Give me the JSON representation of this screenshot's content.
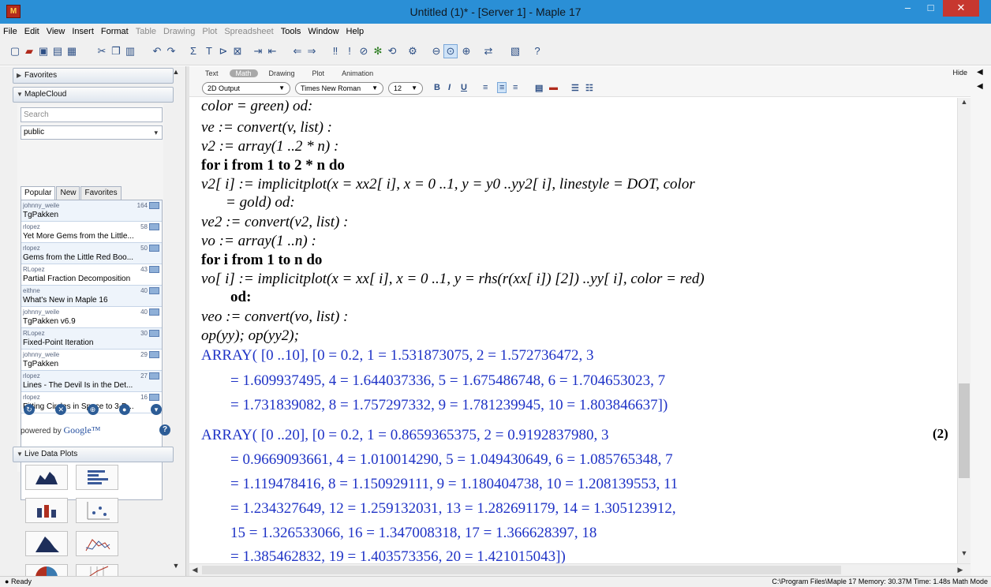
{
  "window": {
    "title": "Untitled (1)* - [Server 1] - Maple 17",
    "minimize": "–",
    "maximize": "□",
    "close": "✕"
  },
  "menu": [
    {
      "label": "File",
      "enabled": true
    },
    {
      "label": "Edit",
      "enabled": true
    },
    {
      "label": "View",
      "enabled": true
    },
    {
      "label": "Insert",
      "enabled": true
    },
    {
      "label": "Format",
      "enabled": true
    },
    {
      "label": "Table",
      "enabled": false
    },
    {
      "label": "Drawing",
      "enabled": false
    },
    {
      "label": "Plot",
      "enabled": false
    },
    {
      "label": "Spreadsheet",
      "enabled": false
    },
    {
      "label": "Tools",
      "enabled": true
    },
    {
      "label": "Window",
      "enabled": true
    },
    {
      "label": "Help",
      "enabled": true
    }
  ],
  "palettes": {
    "favorites": "Favorites",
    "maplecloud": "MapleCloud",
    "livedata": "Live Data Plots"
  },
  "cloud": {
    "search_placeholder": "Search",
    "group": "public",
    "tabs": [
      "Popular",
      "New",
      "Favorites"
    ],
    "items": [
      {
        "author": "johnny_weile",
        "rating": "164",
        "title": "TgPakken"
      },
      {
        "author": "rlopez",
        "rating": "58",
        "title": "Yet More Gems from the Little..."
      },
      {
        "author": "rlopez",
        "rating": "50",
        "title": "Gems from the Little Red Boo..."
      },
      {
        "author": "RLopez",
        "rating": "43",
        "title": "Partial Fraction Decomposition"
      },
      {
        "author": "eithne",
        "rating": "40",
        "title": "What's New in Maple 16"
      },
      {
        "author": "johnny_weile",
        "rating": "40",
        "title": "TgPakken v6.9"
      },
      {
        "author": "RLopez",
        "rating": "30",
        "title": "Fixed-Point Iteration"
      },
      {
        "author": "johnny_weile",
        "rating": "29",
        "title": "TgPakken"
      },
      {
        "author": "rlopez",
        "rating": "27",
        "title": "Lines - The Devil Is in the Det..."
      },
      {
        "author": "rlopez",
        "rating": "16",
        "title": "Fitting Circles in Space to 3-D..."
      }
    ],
    "powered_by": "powered by",
    "google": "Google™"
  },
  "modes": {
    "tabs": [
      "Text",
      "Math",
      "Drawing",
      "Plot",
      "Animation"
    ],
    "active": "Math",
    "hide": "Hide"
  },
  "format": {
    "output": "2D Output",
    "font": "Times New Roman",
    "size": "12"
  },
  "worksheet": {
    "lines": [
      "color = green) od:",
      "ve := convert(v, list) :",
      "v2 := array(1 ..2 * n) :",
      "for i from 1 to 2 * n do",
      "v2[ i] := implicitplot(x = xx2[ i], x = 0 ..1, y = y0 ..yy2[ i], linestyle = DOT, color",
      "= gold) od:",
      "ve2 := convert(v2, list) :",
      "vo := array(1 ..n) :",
      "for i from 1 to n do",
      "vo[ i] := implicitplot(x = xx[ i], x = 0 ..1, y = rhs(r(xx[ i]) [2]) ..yy[ i], color = red)",
      "od:",
      "veo := convert(vo, list) :",
      "op(yy); op(yy2);"
    ],
    "output": [
      "ARRAY( [0 ..10], [0 = 0.2, 1 = 1.531873075, 2 = 1.572736472, 3",
      "= 1.609937495, 4 = 1.644037336, 5 = 1.675486748, 6 = 1.704653023, 7",
      "= 1.731839082, 8 = 1.757297332, 9 = 1.781239945, 10 = 1.803846637])",
      "ARRAY( [0 ..20], [0 = 0.2, 1 = 0.8659365375, 2 = 0.9192837980, 3",
      "= 0.9669093661, 4 = 1.010014290, 5 = 1.049430649, 6 = 1.085765348, 7",
      "= 1.119478416, 8 = 1.150929111, 9 = 1.180404738, 10 = 1.208139553, 11",
      "= 1.234327649, 12 = 1.259132031, 13 = 1.282691179, 14 = 1.305123912,",
      "15 = 1.326533066, 16 = 1.347008318, 17 = 1.366628397, 18",
      "= 1.385462832, 19 = 1.403573356, 20 = 1.421015043])"
    ],
    "equation_label": "(2)"
  },
  "status": {
    "left": "Ready",
    "right": "C:\\Program Files\\Maple 17   Memory: 30.37M   Time: 1.48s   Math Mode"
  },
  "colors": {
    "titlebar": "#2a8fd6",
    "output_text": "#1f33c6"
  }
}
